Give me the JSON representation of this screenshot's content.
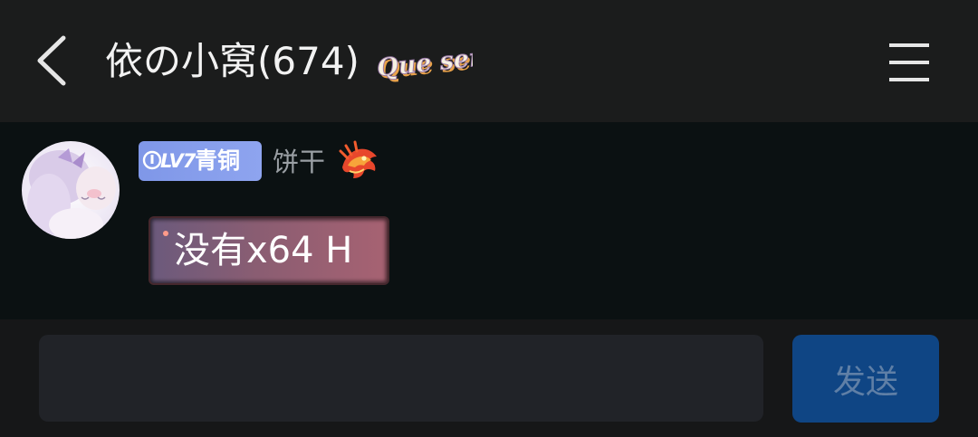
{
  "header": {
    "title": "依の小窝(674)",
    "title_badge": "Que sera",
    "back_icon": "chevron-left-icon",
    "menu_icon": "menu-icon"
  },
  "message": {
    "level": "LV7",
    "level_title": "青铜",
    "username": "饼干",
    "text": "没有x64 H"
  },
  "composer": {
    "input_value": "",
    "send_label": "发送"
  },
  "colors": {
    "header_bg": "#1b1c1c",
    "chat_bg": "#0b1112",
    "composer_bg": "#161718",
    "level_badge": "#8ea4ef",
    "send_button": "#0f4584"
  }
}
